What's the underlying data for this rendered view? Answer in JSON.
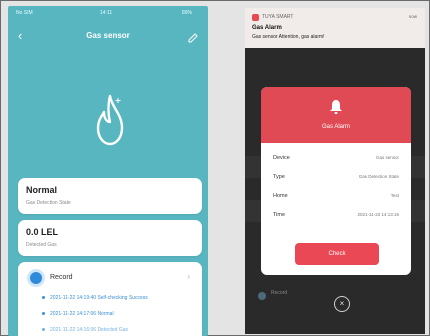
{
  "left": {
    "status": {
      "carrier": "No SIM",
      "time": "14:11",
      "battery": "89%"
    },
    "nav": {
      "back": "‹",
      "title": "Gas sensor"
    },
    "state": {
      "value": "Normal",
      "label": "Gas Detection State"
    },
    "gas": {
      "value": "0.0 LEL",
      "label": "Detected Gas"
    },
    "record": {
      "title": "Record",
      "arrow": "›",
      "lines": [
        "2021-11-22 14:19:40 Self-checking Success",
        "2021-11-22 14:17:06 Normal",
        "2021-11-22 14:16:06 Detected Gas"
      ]
    },
    "colors": {
      "background": "#58b6c1",
      "accent": "#2f8bd9"
    }
  },
  "right": {
    "notification": {
      "app": "TUYA SMART",
      "time": "now",
      "title": "Gas Alarm",
      "body": "Gas sensor Attention, gas alarm!"
    },
    "modal": {
      "title": "Gas Alarm",
      "rows": [
        {
          "key": "Device",
          "value": "Gas sensor"
        },
        {
          "key": "Type",
          "value": "Gas Detection State"
        },
        {
          "key": "Home",
          "value": "Test"
        },
        {
          "key": "Time",
          "value": "2021-11-22 14:13:16"
        }
      ],
      "check_label": "Check"
    },
    "close_label": "×",
    "bg_record": "Record",
    "colors": {
      "alarm": "#e04a55"
    }
  }
}
